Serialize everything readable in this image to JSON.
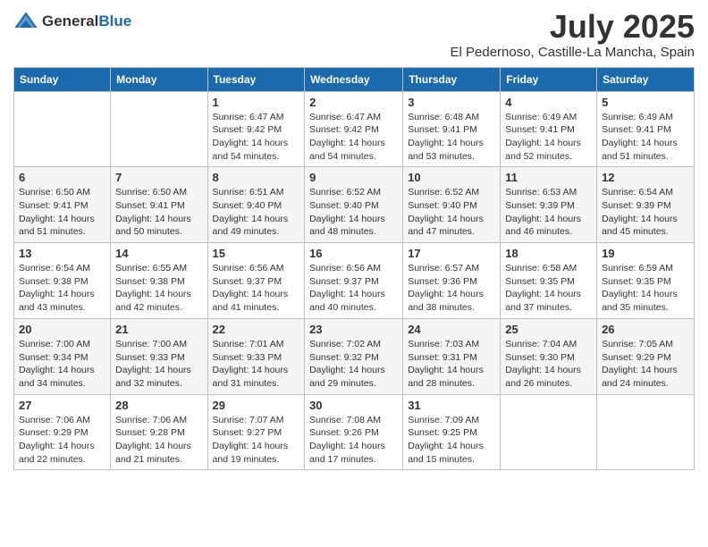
{
  "header": {
    "logo_general": "General",
    "logo_blue": "Blue",
    "title": "July 2025",
    "subtitle": "El Pedernoso, Castille-La Mancha, Spain"
  },
  "days_of_week": [
    "Sunday",
    "Monday",
    "Tuesday",
    "Wednesday",
    "Thursday",
    "Friday",
    "Saturday"
  ],
  "weeks": [
    [
      {
        "day": "",
        "sunrise": "",
        "sunset": "",
        "daylight": ""
      },
      {
        "day": "",
        "sunrise": "",
        "sunset": "",
        "daylight": ""
      },
      {
        "day": "1",
        "sunrise": "Sunrise: 6:47 AM",
        "sunset": "Sunset: 9:42 PM",
        "daylight": "Daylight: 14 hours and 54 minutes."
      },
      {
        "day": "2",
        "sunrise": "Sunrise: 6:47 AM",
        "sunset": "Sunset: 9:42 PM",
        "daylight": "Daylight: 14 hours and 54 minutes."
      },
      {
        "day": "3",
        "sunrise": "Sunrise: 6:48 AM",
        "sunset": "Sunset: 9:41 PM",
        "daylight": "Daylight: 14 hours and 53 minutes."
      },
      {
        "day": "4",
        "sunrise": "Sunrise: 6:49 AM",
        "sunset": "Sunset: 9:41 PM",
        "daylight": "Daylight: 14 hours and 52 minutes."
      },
      {
        "day": "5",
        "sunrise": "Sunrise: 6:49 AM",
        "sunset": "Sunset: 9:41 PM",
        "daylight": "Daylight: 14 hours and 51 minutes."
      }
    ],
    [
      {
        "day": "6",
        "sunrise": "Sunrise: 6:50 AM",
        "sunset": "Sunset: 9:41 PM",
        "daylight": "Daylight: 14 hours and 51 minutes."
      },
      {
        "day": "7",
        "sunrise": "Sunrise: 6:50 AM",
        "sunset": "Sunset: 9:41 PM",
        "daylight": "Daylight: 14 hours and 50 minutes."
      },
      {
        "day": "8",
        "sunrise": "Sunrise: 6:51 AM",
        "sunset": "Sunset: 9:40 PM",
        "daylight": "Daylight: 14 hours and 49 minutes."
      },
      {
        "day": "9",
        "sunrise": "Sunrise: 6:52 AM",
        "sunset": "Sunset: 9:40 PM",
        "daylight": "Daylight: 14 hours and 48 minutes."
      },
      {
        "day": "10",
        "sunrise": "Sunrise: 6:52 AM",
        "sunset": "Sunset: 9:40 PM",
        "daylight": "Daylight: 14 hours and 47 minutes."
      },
      {
        "day": "11",
        "sunrise": "Sunrise: 6:53 AM",
        "sunset": "Sunset: 9:39 PM",
        "daylight": "Daylight: 14 hours and 46 minutes."
      },
      {
        "day": "12",
        "sunrise": "Sunrise: 6:54 AM",
        "sunset": "Sunset: 9:39 PM",
        "daylight": "Daylight: 14 hours and 45 minutes."
      }
    ],
    [
      {
        "day": "13",
        "sunrise": "Sunrise: 6:54 AM",
        "sunset": "Sunset: 9:38 PM",
        "daylight": "Daylight: 14 hours and 43 minutes."
      },
      {
        "day": "14",
        "sunrise": "Sunrise: 6:55 AM",
        "sunset": "Sunset: 9:38 PM",
        "daylight": "Daylight: 14 hours and 42 minutes."
      },
      {
        "day": "15",
        "sunrise": "Sunrise: 6:56 AM",
        "sunset": "Sunset: 9:37 PM",
        "daylight": "Daylight: 14 hours and 41 minutes."
      },
      {
        "day": "16",
        "sunrise": "Sunrise: 6:56 AM",
        "sunset": "Sunset: 9:37 PM",
        "daylight": "Daylight: 14 hours and 40 minutes."
      },
      {
        "day": "17",
        "sunrise": "Sunrise: 6:57 AM",
        "sunset": "Sunset: 9:36 PM",
        "daylight": "Daylight: 14 hours and 38 minutes."
      },
      {
        "day": "18",
        "sunrise": "Sunrise: 6:58 AM",
        "sunset": "Sunset: 9:35 PM",
        "daylight": "Daylight: 14 hours and 37 minutes."
      },
      {
        "day": "19",
        "sunrise": "Sunrise: 6:59 AM",
        "sunset": "Sunset: 9:35 PM",
        "daylight": "Daylight: 14 hours and 35 minutes."
      }
    ],
    [
      {
        "day": "20",
        "sunrise": "Sunrise: 7:00 AM",
        "sunset": "Sunset: 9:34 PM",
        "daylight": "Daylight: 14 hours and 34 minutes."
      },
      {
        "day": "21",
        "sunrise": "Sunrise: 7:00 AM",
        "sunset": "Sunset: 9:33 PM",
        "daylight": "Daylight: 14 hours and 32 minutes."
      },
      {
        "day": "22",
        "sunrise": "Sunrise: 7:01 AM",
        "sunset": "Sunset: 9:33 PM",
        "daylight": "Daylight: 14 hours and 31 minutes."
      },
      {
        "day": "23",
        "sunrise": "Sunrise: 7:02 AM",
        "sunset": "Sunset: 9:32 PM",
        "daylight": "Daylight: 14 hours and 29 minutes."
      },
      {
        "day": "24",
        "sunrise": "Sunrise: 7:03 AM",
        "sunset": "Sunset: 9:31 PM",
        "daylight": "Daylight: 14 hours and 28 minutes."
      },
      {
        "day": "25",
        "sunrise": "Sunrise: 7:04 AM",
        "sunset": "Sunset: 9:30 PM",
        "daylight": "Daylight: 14 hours and 26 minutes."
      },
      {
        "day": "26",
        "sunrise": "Sunrise: 7:05 AM",
        "sunset": "Sunset: 9:29 PM",
        "daylight": "Daylight: 14 hours and 24 minutes."
      }
    ],
    [
      {
        "day": "27",
        "sunrise": "Sunrise: 7:06 AM",
        "sunset": "Sunset: 9:29 PM",
        "daylight": "Daylight: 14 hours and 22 minutes."
      },
      {
        "day": "28",
        "sunrise": "Sunrise: 7:06 AM",
        "sunset": "Sunset: 9:28 PM",
        "daylight": "Daylight: 14 hours and 21 minutes."
      },
      {
        "day": "29",
        "sunrise": "Sunrise: 7:07 AM",
        "sunset": "Sunset: 9:27 PM",
        "daylight": "Daylight: 14 hours and 19 minutes."
      },
      {
        "day": "30",
        "sunrise": "Sunrise: 7:08 AM",
        "sunset": "Sunset: 9:26 PM",
        "daylight": "Daylight: 14 hours and 17 minutes."
      },
      {
        "day": "31",
        "sunrise": "Sunrise: 7:09 AM",
        "sunset": "Sunset: 9:25 PM",
        "daylight": "Daylight: 14 hours and 15 minutes."
      },
      {
        "day": "",
        "sunrise": "",
        "sunset": "",
        "daylight": ""
      },
      {
        "day": "",
        "sunrise": "",
        "sunset": "",
        "daylight": ""
      }
    ]
  ]
}
